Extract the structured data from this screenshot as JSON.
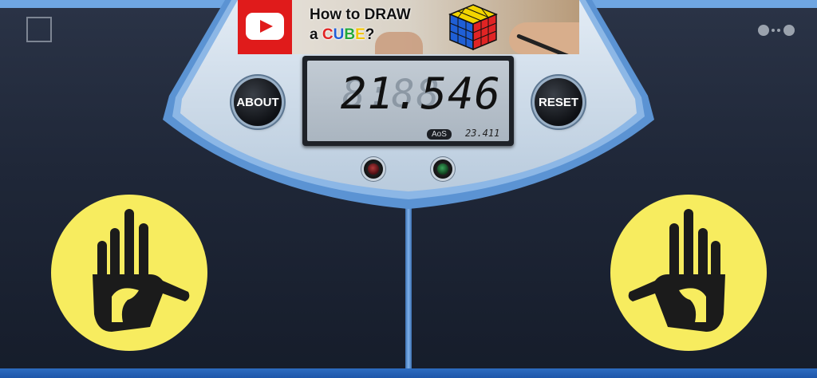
{
  "timer": {
    "time": "21.546",
    "ghost_digits": "8:88",
    "aos_label": "AoS",
    "aos_value": "23.411"
  },
  "buttons": {
    "about": "ABOUT",
    "reset": "RESET"
  },
  "ad": {
    "line1": "How to DRAW",
    "line2_prefix": "a ",
    "line2_word": [
      "C",
      "U",
      "B",
      "E"
    ],
    "line2_suffix": "?"
  },
  "colors": {
    "pad": "#f7ec5f",
    "console": "#c9d9ea",
    "accent_blue": "#4f8fd4",
    "indicator_red": "#b03a3a",
    "indicator_green": "#3aa35a"
  },
  "icons": [
    "menu-square-icon",
    "more-dots-icon",
    "youtube-play-icon",
    "hand-icon"
  ]
}
